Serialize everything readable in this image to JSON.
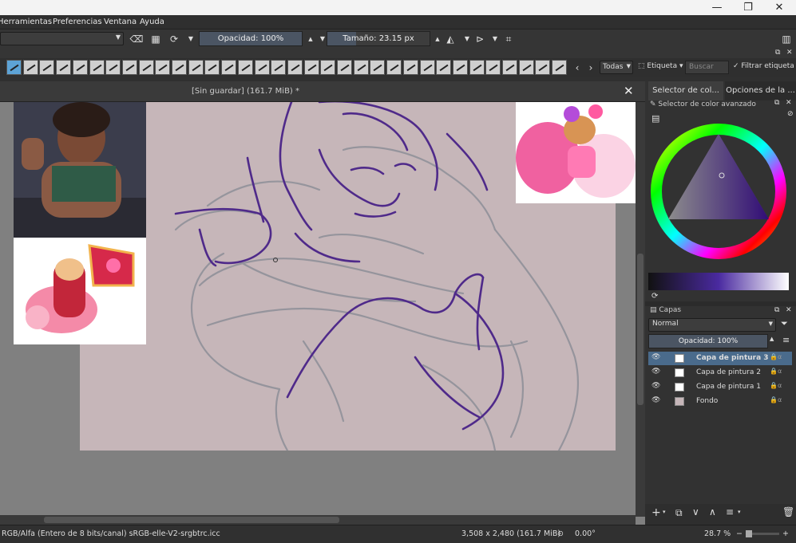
{
  "menu": {
    "items": [
      "Herramientas",
      "Preferencias",
      "Ventana",
      "Ayuda"
    ]
  },
  "toolbar": {
    "opacity_label": "Opacidad: 100%",
    "size_label": "Tamaño: 23.15 px",
    "opacity_level": 1.0,
    "size_fill": 0.28
  },
  "brushbar": {
    "tag_filter": "Todas",
    "tag_label": "Etiqueta",
    "search_placeholder": "Buscar",
    "filter_tag_label": "Filtrar etiqueta"
  },
  "document": {
    "title": "[Sin guardar]  (161.7 MiB) *"
  },
  "right_panel": {
    "tabs": [
      "Selector de col...",
      "Opciones de la ..."
    ],
    "advanced_color_label": "Selector de color avanzado",
    "layers_title": "Capas",
    "blend_mode": "Normal",
    "layer_opacity": "Opacidad:  100%",
    "layers": [
      {
        "name": "Capa de pintura 3"
      },
      {
        "name": "Capa de pintura 2"
      },
      {
        "name": "Capa de pintura 1"
      },
      {
        "name": "Fondo"
      }
    ]
  },
  "status": {
    "color_model": "RGB/Alfa (Entero de 8 bits/canal)  sRGB-elle-V2-srgbtrc.icc",
    "dimensions": "3,508 x 2,480 (161.7 MiB)",
    "rotation": "0.00°",
    "zoom": "28.7 %"
  },
  "colors": {
    "accent": "#5da3d6",
    "canvas_bg": "#c6b6b9",
    "stroke_purple": "#4f2a8a",
    "stroke_gray": "#8d8f98"
  }
}
